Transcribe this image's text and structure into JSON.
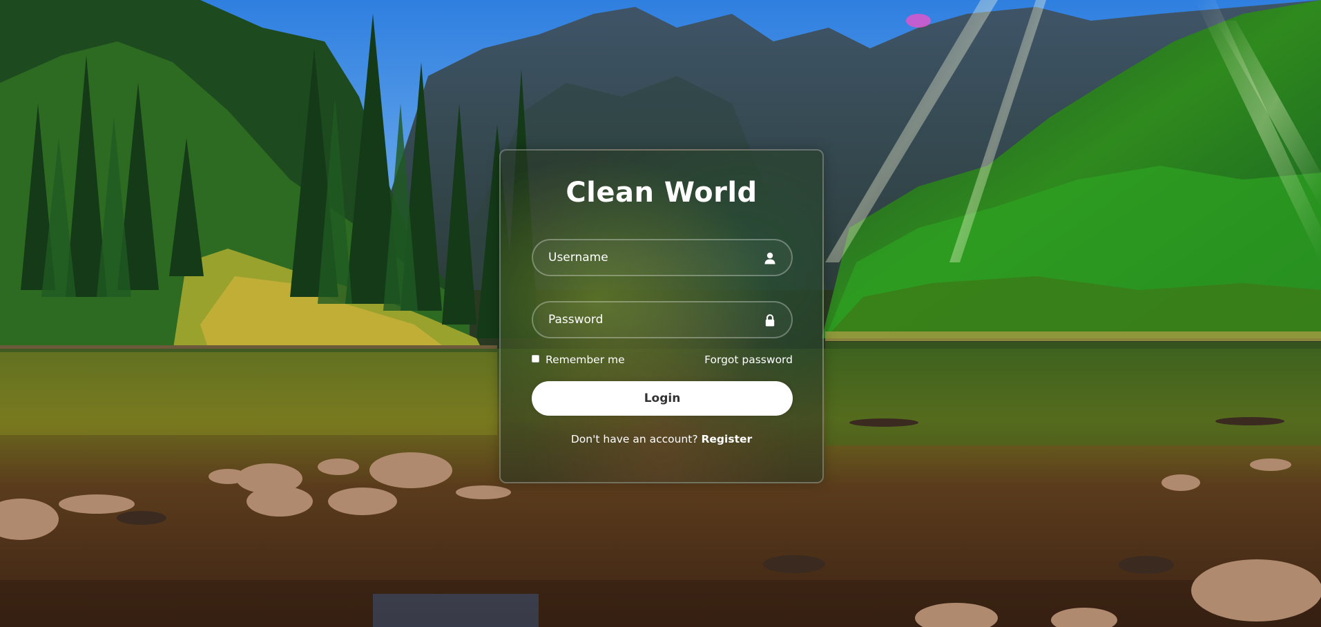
{
  "page": {
    "background_description_icon": "mountain-lake-landscape"
  },
  "login": {
    "title": "Clean World",
    "username_placeholder": "Username",
    "password_placeholder": "Password",
    "remember_label": "Remember me",
    "forgot_label": "Forgot password",
    "login_label": "Login",
    "register_prompt": "Don't have an account?",
    "register_label": "Register"
  },
  "icons": {
    "username": "user-icon",
    "password": "lock-icon"
  },
  "colors": {
    "text": "#ffffff",
    "button_bg": "#ffffff",
    "button_text": "#333333",
    "sky": "#3e8ee6",
    "forest": "#2f6a1f",
    "water": "#5a3a1e"
  }
}
